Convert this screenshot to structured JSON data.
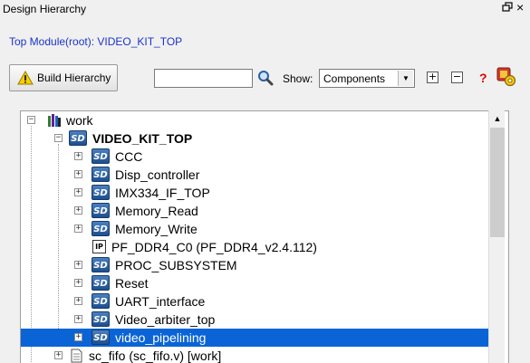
{
  "window": {
    "title": "Design Hierarchy"
  },
  "top_module": "Top Module(root): VIDEO_KIT_TOP",
  "toolbar": {
    "build_label": "Build Hierarchy",
    "search_value": "",
    "show_label": "Show:",
    "show_value": "Components",
    "expand_symbol": "+",
    "collapse_symbol": "−",
    "help_symbol": "?"
  },
  "tree": {
    "rows": [
      {
        "label": "work",
        "icon": "library-icon",
        "expander": "−"
      },
      {
        "label": "VIDEO_KIT_TOP",
        "icon": "sd-icon",
        "expander": "−"
      },
      {
        "label": "CCC",
        "icon": "sd-icon",
        "expander": "+"
      },
      {
        "label": "Disp_controller",
        "icon": "sd-icon",
        "expander": "+"
      },
      {
        "label": "IMX334_IF_TOP",
        "icon": "sd-icon",
        "expander": "+"
      },
      {
        "label": "Memory_Read",
        "icon": "sd-icon",
        "expander": "+"
      },
      {
        "label": "Memory_Write",
        "icon": "sd-icon",
        "expander": "+"
      },
      {
        "label": "PF_DDR4_C0 (PF_DDR4_v2.4.112)",
        "icon": "ip-icon",
        "expander": ""
      },
      {
        "label": "PROC_SUBSYSTEM",
        "icon": "sd-icon",
        "expander": "+"
      },
      {
        "label": "Reset",
        "icon": "sd-icon",
        "expander": "+"
      },
      {
        "label": "UART_interface",
        "icon": "sd-icon",
        "expander": "+"
      },
      {
        "label": "Video_arbiter_top",
        "icon": "sd-icon",
        "expander": "+"
      },
      {
        "label": "video_pipelining",
        "icon": "sd-icon",
        "expander": "+",
        "selected": true
      },
      {
        "label": "sc_fifo (sc_fifo.v) [work]",
        "icon": "file-icon",
        "expander": "+"
      }
    ],
    "sd_icon_text": "SD",
    "ip_icon_text": "IP"
  },
  "colors": {
    "accent": "#1a33cc",
    "selection": "#0a64d6",
    "sd_icon": "#2a5fa0"
  }
}
